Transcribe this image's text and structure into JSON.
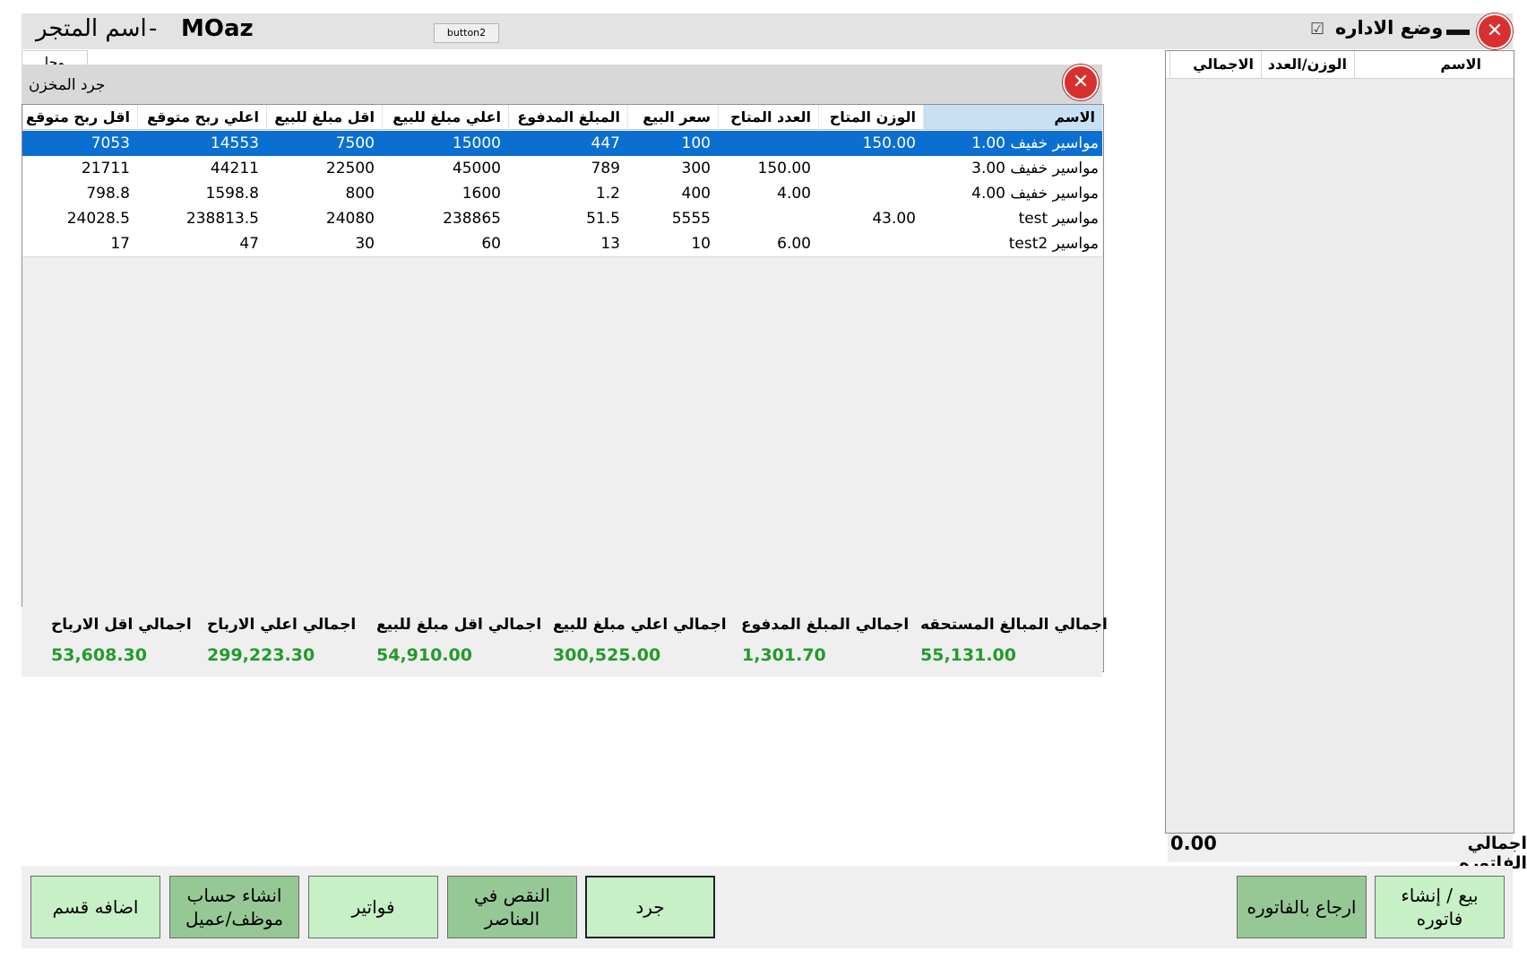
{
  "titlebar": {
    "store_name": "اسم المتجر",
    "separator": "-",
    "user": "MOaz",
    "button2": "button2",
    "admin_mode_label": "وضع الاداره",
    "admin_mode_checked": true,
    "admin_check_glyph": "☑",
    "minimize_glyph": "—",
    "close_glyph": "✕",
    "tab_fragment": "وحا"
  },
  "cart": {
    "columns": [
      "الاسم",
      "الوزن/العدد",
      "الاجمالي"
    ],
    "total_label": "اجمالي الفاتوره",
    "total_value": "0.00"
  },
  "inventory": {
    "title": "جرد المخزن",
    "close_glyph": "✕",
    "columns": [
      "الاسم",
      "الوزن المتاح",
      "العدد المتاح",
      "سعر البيع",
      "المبلغ المدفوع",
      "اعلي مبلغ للبيع",
      "اقل مبلغ للبيع",
      "اعلي ربح متوقع",
      "اقل ربح متوقع"
    ],
    "rows": [
      [
        "مواسير خفيف 1.00",
        "150.00",
        "",
        "100",
        "447",
        "15000",
        "7500",
        "14553",
        "7053"
      ],
      [
        "مواسير خفيف 3.00",
        "",
        "150.00",
        "300",
        "789",
        "45000",
        "22500",
        "44211",
        "21711"
      ],
      [
        "مواسير خفيف 4.00",
        "",
        "4.00",
        "400",
        "1.2",
        "1600",
        "800",
        "1598.8",
        "798.8"
      ],
      [
        "مواسير test",
        "43.00",
        "",
        "5555",
        "51.5",
        "238865",
        "24080",
        "238813.5",
        "24028.5"
      ],
      [
        "مواسير test2",
        "",
        "6.00",
        "10",
        "13",
        "60",
        "30",
        "47",
        "17"
      ]
    ],
    "selected_row": 0,
    "totals": [
      {
        "label": "اجمالي المبالغ المستحقه",
        "value": "55,131.00"
      },
      {
        "label": "اجمالي المبلغ المدفوع",
        "value": "1,301.70"
      },
      {
        "label": "اجمالي اعلي مبلغ للبيع",
        "value": "300,525.00"
      },
      {
        "label": "اجمالي اقل مبلغ للبيع",
        "value": "54,910.00"
      },
      {
        "label": "اجمالي اعلي الارباح",
        "value": "299,223.30"
      },
      {
        "label": "اجمالي اقل الارباح",
        "value": "53,608.30"
      }
    ]
  },
  "buttons": {
    "add_category": "اضافه قسم",
    "create_account_1": "انشاء حساب",
    "create_account_2": "موظف/عميل",
    "invoices": "فواتير",
    "shortage_1": "النقص في",
    "shortage_2": "العناصر",
    "inventory": "جرد",
    "return_invoice": "ارجاع بالفاتوره",
    "sell_1": "بيع / إنشاء",
    "sell_2": "فاتوره"
  },
  "colors": {
    "selection": "#0b6fd1",
    "totals_green": "#239b2b",
    "button_light": "#c7f0c7",
    "button_dark": "#95c895",
    "close_red": "#d92f2f"
  }
}
